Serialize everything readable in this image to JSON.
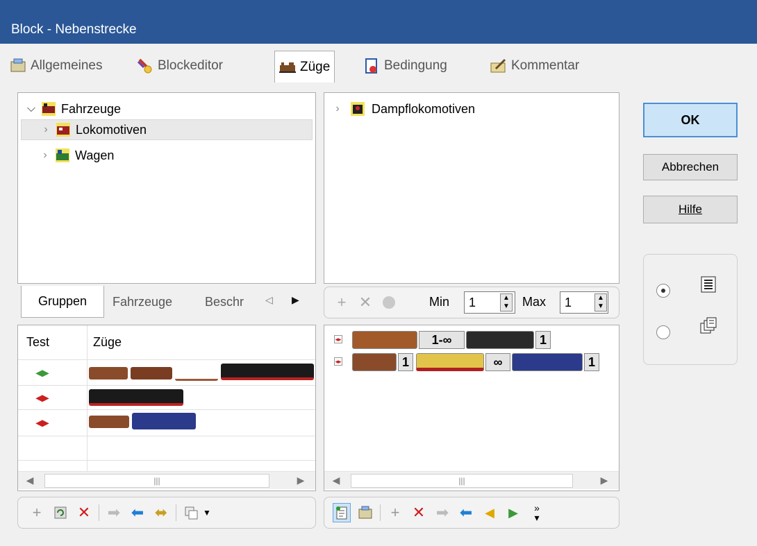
{
  "window": {
    "title": "Block - Nebenstrecke"
  },
  "tabs": [
    {
      "label": "Allgemeines",
      "icon": "properties-icon"
    },
    {
      "label": "Blockeditor",
      "icon": "block-editor-icon"
    },
    {
      "label": "Züge",
      "icon": "train-icon",
      "active": true
    },
    {
      "label": "Bedingung",
      "icon": "condition-icon"
    },
    {
      "label": "Kommentar",
      "icon": "comment-icon"
    }
  ],
  "left_tree": {
    "items": [
      {
        "label": "Fahrzeuge",
        "expanded": true
      },
      {
        "label": "Lokomotiven",
        "selected": true
      },
      {
        "label": "Wagen"
      }
    ]
  },
  "right_tree": {
    "items": [
      {
        "label": "Dampflokomotiven"
      }
    ]
  },
  "subtabs": {
    "groups": "Gruppen",
    "vehicles": "Fahrzeuge",
    "description": "Beschr"
  },
  "minmax": {
    "min_label": "Min",
    "min_value": "1",
    "max_label": "Max",
    "max_value": "1"
  },
  "grid": {
    "columns": [
      "Test",
      "Züge"
    ],
    "rows": [
      {
        "signal": "green"
      },
      {
        "signal": "red"
      },
      {
        "signal": "red"
      }
    ]
  },
  "compositions": [
    {
      "cells": [
        "1-∞",
        "1"
      ]
    },
    {
      "cells": [
        "1",
        "∞",
        "1"
      ]
    }
  ],
  "buttons": {
    "ok": "OK",
    "cancel": "Abbrechen",
    "help": "Hilfe"
  },
  "colors": {
    "titlebar": "#2b5797",
    "ok_border": "#4a8fd6",
    "signal_green": "#3a9a3a",
    "signal_red": "#cc1f1f",
    "delete_red": "#d11b1b",
    "arrow_blue": "#1e7fd6"
  }
}
